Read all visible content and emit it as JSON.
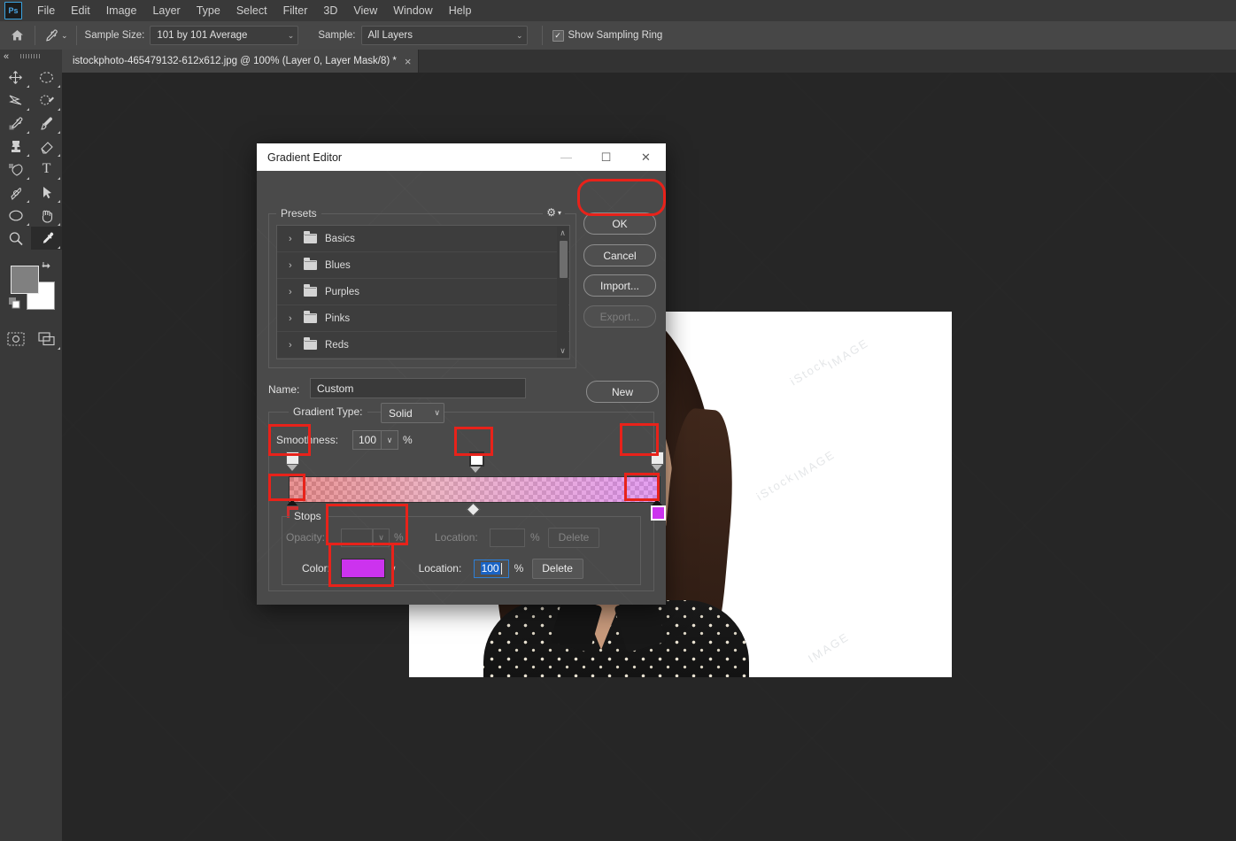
{
  "app": {
    "logo": "Ps",
    "menu": [
      "File",
      "Edit",
      "Image",
      "Layer",
      "Type",
      "Select",
      "Filter",
      "3D",
      "View",
      "Window",
      "Help"
    ]
  },
  "options_bar": {
    "home_icon": "home-icon",
    "tool_icon": "eyedropper-icon",
    "sample_size_label": "Sample Size:",
    "sample_size_value": "101 by 101 Average",
    "sample_label": "Sample:",
    "sample_value": "All Layers",
    "show_sampling_ring_label": "Show Sampling Ring",
    "show_sampling_ring_checked": true,
    "check_glyph": "✓"
  },
  "toolbar": {
    "tools": [
      {
        "name": "move-tool",
        "glyph": "✛"
      },
      {
        "name": "marquee-tool",
        "glyph": "◌"
      },
      {
        "name": "lasso-tool",
        "glyph": "➤"
      },
      {
        "name": "quick-selection-tool",
        "glyph": "❁"
      },
      {
        "name": "eyedropper-tool",
        "glyph": "✑"
      },
      {
        "name": "brush-tool",
        "glyph": "✎"
      },
      {
        "name": "clone-stamp-tool",
        "glyph": "☗"
      },
      {
        "name": "eraser-tool",
        "glyph": "✂"
      },
      {
        "name": "gradient-tool",
        "glyph": "◢"
      },
      {
        "name": "type-tool",
        "glyph": "T"
      },
      {
        "name": "pen-tool",
        "glyph": "✒"
      },
      {
        "name": "path-selection-tool",
        "glyph": "➤"
      },
      {
        "name": "ellipse-tool",
        "glyph": "⬭"
      },
      {
        "name": "hand-tool",
        "glyph": "✋"
      },
      {
        "name": "zoom-tool",
        "glyph": "⚲"
      },
      {
        "name": "eyedropper-active-tool",
        "glyph": "✑"
      }
    ],
    "foreground_color": "#808080",
    "background_color": "#ffffff",
    "swap_icon": "swap-colors-icon",
    "default_colors_icon": "default-colors-icon",
    "quick_mask_icon": "quick-mask-icon",
    "screen_mode_icon": "screen-mode-icon"
  },
  "tabs": {
    "collapse_glyph": "«",
    "document": {
      "title": "istockphoto-465479132-612x612.jpg @ 100% (Layer 0, Layer Mask/8) *",
      "close_glyph": "×"
    }
  },
  "canvas": {
    "watermarks": [
      "iStock",
      "IMAGE",
      "iStock",
      "IMAGE",
      "IMAGE"
    ]
  },
  "dialog": {
    "title": "Gradient Editor",
    "window_buttons": {
      "minimize": "—",
      "maximize": "☐",
      "close": "✕"
    },
    "presets": {
      "group_label": "Presets",
      "gear_icon": "gear-icon",
      "gear_glyph": "⚙",
      "gear_caret": "▾",
      "scroll_up": "∧",
      "scroll_down": "∨",
      "items": [
        {
          "label": "Basics",
          "chevron": "›",
          "icon": "folder-icon"
        },
        {
          "label": "Blues",
          "chevron": "›",
          "icon": "folder-icon"
        },
        {
          "label": "Purples",
          "chevron": "›",
          "icon": "folder-icon"
        },
        {
          "label": "Pinks",
          "chevron": "›",
          "icon": "folder-icon"
        },
        {
          "label": "Reds",
          "chevron": "›",
          "icon": "folder-icon"
        }
      ]
    },
    "buttons": {
      "ok": "OK",
      "cancel": "Cancel",
      "import": "Import...",
      "export": "Export...",
      "new": "New"
    },
    "name": {
      "label": "Name:",
      "value": "Custom"
    },
    "gradient_type": {
      "label": "Gradient Type:",
      "value": "Solid",
      "caret": "∨"
    },
    "smoothness": {
      "label": "Smoothness:",
      "value": "100",
      "caret": "∨",
      "unit": "%"
    },
    "gradient": {
      "color_stops": [
        {
          "position_pct": 0,
          "color": "#cc2f2f",
          "selected": false
        },
        {
          "position_pct": 100,
          "color": "#cc33ee",
          "selected": true
        }
      ],
      "opacity_stops": [
        {
          "position_pct": 0,
          "selected": false
        },
        {
          "position_pct": 50,
          "selected": true
        },
        {
          "position_pct": 100,
          "selected": false
        }
      ],
      "midpoint_pct": 50
    },
    "stops": {
      "group_label": "Stops",
      "opacity": {
        "label": "Opacity:",
        "value": "",
        "unit": "%",
        "caret": "∨",
        "location_label": "Location:",
        "location_value": "",
        "location_unit": "%",
        "delete_label": "Delete",
        "enabled": false
      },
      "color": {
        "label": "Color:",
        "swatch": "#cc33ee",
        "caret": "∨",
        "location_label": "Location:",
        "location_value": "100",
        "location_unit": "%",
        "delete_label": "Delete",
        "enabled": true
      }
    }
  },
  "annotations": {
    "color": "#e8221a",
    "boxes": [
      {
        "name": "ok-button-highlight"
      },
      {
        "name": "left-opacity-stop-highlight"
      },
      {
        "name": "middle-opacity-stop-highlight"
      },
      {
        "name": "right-opacity-stop-highlight"
      },
      {
        "name": "left-color-stop-highlight"
      },
      {
        "name": "right-color-stop-highlight"
      },
      {
        "name": "opacity-field-highlight"
      },
      {
        "name": "color-swatch-highlight"
      }
    ]
  }
}
